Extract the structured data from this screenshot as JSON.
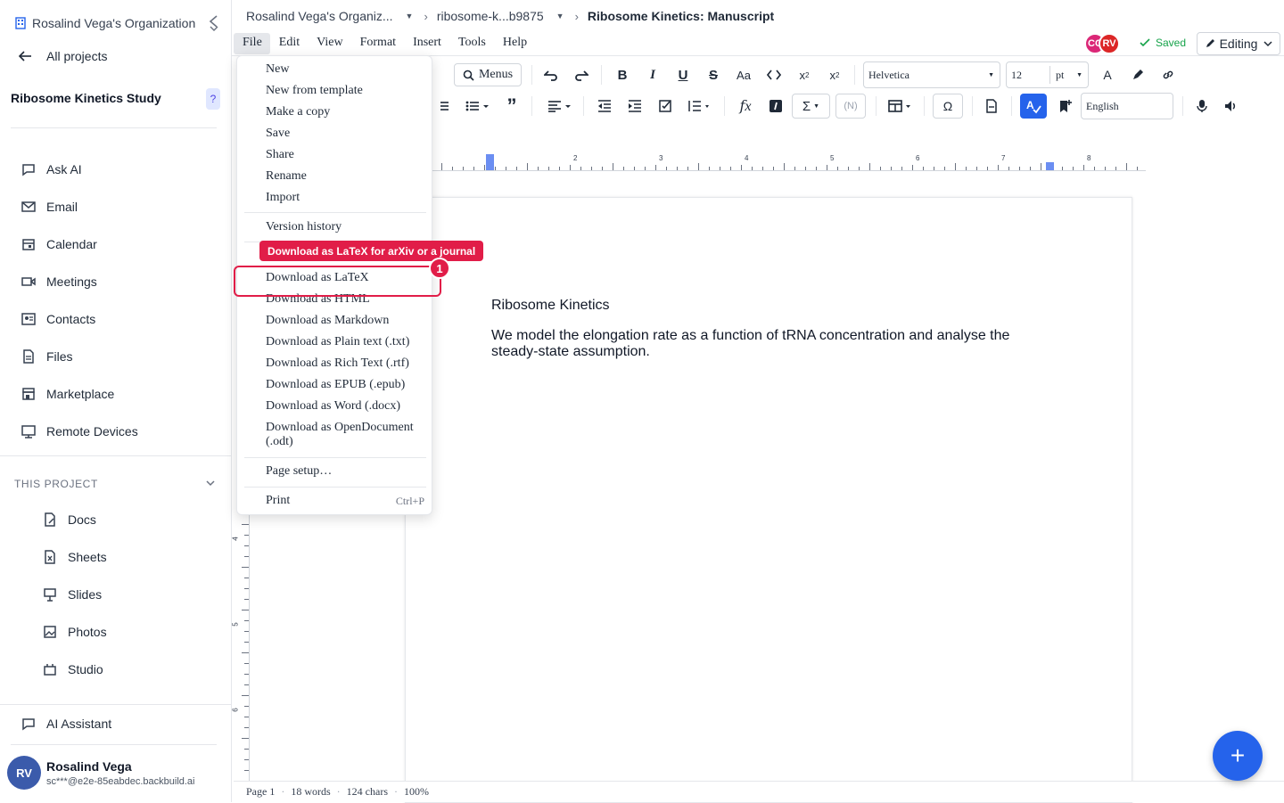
{
  "sidebar": {
    "org_name": "Rosalind Vega's Organization",
    "all_projects": "All projects",
    "project_name": "Ribosome Kinetics Study",
    "help_label": "?",
    "nav": [
      {
        "label": "Ask AI",
        "icon": "chat-icon"
      },
      {
        "label": "Email",
        "icon": "mail-icon"
      },
      {
        "label": "Calendar",
        "icon": "calendar-icon"
      },
      {
        "label": "Meetings",
        "icon": "video-icon"
      },
      {
        "label": "Contacts",
        "icon": "contacts-icon"
      },
      {
        "label": "Files",
        "icon": "files-icon"
      },
      {
        "label": "Marketplace",
        "icon": "store-icon"
      },
      {
        "label": "Remote Devices",
        "icon": "monitor-icon"
      }
    ],
    "section_title": "THIS PROJECT",
    "project_items": [
      {
        "label": "Docs",
        "icon": "docs-icon"
      },
      {
        "label": "Sheets",
        "icon": "sheets-icon"
      },
      {
        "label": "Slides",
        "icon": "slides-icon"
      },
      {
        "label": "Photos",
        "icon": "photos-icon"
      },
      {
        "label": "Studio",
        "icon": "studio-icon"
      }
    ],
    "assistant": "AI Assistant",
    "user": {
      "initials": "RV",
      "name": "Rosalind Vega",
      "email": "sc***@e2e-85eabdec.backbuild.ai"
    }
  },
  "topbar": {
    "org": "Rosalind Vega's Organiz...",
    "project": "ribosome-k...b9875",
    "doc_title": "Ribosome Kinetics: Manuscript"
  },
  "menubar": [
    "File",
    "Edit",
    "View",
    "Format",
    "Insert",
    "Tools",
    "Help"
  ],
  "collaborators": [
    {
      "initials": "CC",
      "color": "#db2777"
    },
    {
      "initials": "RV",
      "color": "#dc2626"
    }
  ],
  "status": {
    "saved": "Saved",
    "mode": "Editing"
  },
  "toolbar": {
    "menus_label": "Menus",
    "font": "Helvetica",
    "size": "12",
    "unit": "pt",
    "language": "English"
  },
  "ruler": {
    "numbers": [
      "2",
      "3",
      "4",
      "5",
      "6",
      "7",
      "8"
    ],
    "vnumbers": [
      "4",
      "5",
      "6"
    ]
  },
  "document": {
    "heading": "Ribosome Kinetics",
    "paragraph": "We model the elongation rate as a function of tRNA concentration and analyse the steady-state assumption."
  },
  "statusbar": {
    "page": "Page 1",
    "words": "18 words",
    "chars": "124 chars",
    "zoom": "100%"
  },
  "file_menu": {
    "items": [
      "New",
      "New from template",
      "Make a copy",
      "Save",
      "Share",
      "Rename",
      "Import"
    ],
    "version_history": "Version history",
    "downloads": [
      "Download as LaTeX",
      "Download as HTML",
      "Download as Markdown",
      "Download as Plain text (.txt)",
      "Download as Rich Text (.rtf)",
      "Download as EPUB (.epub)",
      "Download as Word (.docx)",
      "Download as OpenDocument (.odt)"
    ],
    "page_setup": "Page setup…",
    "print": "Print",
    "print_shortcut": "Ctrl+P"
  },
  "annotation": {
    "tooltip": "Download as LaTeX for arXiv or a journal",
    "step": "1",
    "color": "#e11d48"
  }
}
